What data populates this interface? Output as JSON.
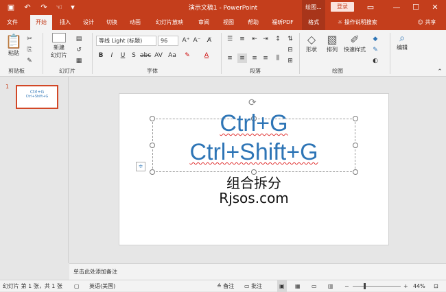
{
  "window": {
    "doc_title": "演示文稿1  -  PowerPoint",
    "context_tab": "绘图...",
    "login": "登录"
  },
  "quick_access": [
    "save-icon",
    "undo-icon",
    "redo-icon",
    "touch-mode-icon",
    "customize-icon"
  ],
  "tabs": [
    {
      "label": "文件"
    },
    {
      "label": "开始"
    },
    {
      "label": "插入"
    },
    {
      "label": "设计"
    },
    {
      "label": "切换"
    },
    {
      "label": "动画"
    },
    {
      "label": "幻灯片放映"
    },
    {
      "label": "审阅"
    },
    {
      "label": "视图"
    },
    {
      "label": "帮助"
    },
    {
      "label": "福昕PDF"
    },
    {
      "label": "格式"
    }
  ],
  "tell_me": "操作说明搜索",
  "share": "共享",
  "ribbon": {
    "paste": "粘贴",
    "new_slide_1": "新建",
    "new_slide_2": "幻灯片",
    "font_name": "等线 Light (标题)",
    "font_size": "96",
    "shape": "形状",
    "arrange": "排列",
    "quick_style": "快速样式",
    "edit": "编辑",
    "groups": {
      "clipboard": "剪贴板",
      "slides": "幻灯片",
      "font": "字体",
      "paragraph": "段落",
      "drawing": "绘图"
    }
  },
  "thumb": {
    "number": "1",
    "line1": "Ctrl+G",
    "line2": "Ctrl+Shift+G"
  },
  "slide": {
    "line1": "Ctrl+G",
    "line2": "Ctrl+Shift+G",
    "line3": "组合拆分",
    "line4": "Rjsos.com"
  },
  "notes": "单击此处添加备注",
  "status": {
    "slide_info": "幻灯片 第 1 张，共 1 张",
    "language": "英语(美国)",
    "notes_btn": "备注",
    "comments_btn": "批注",
    "zoom": "44%"
  },
  "colors": {
    "brand": "#c43e1c",
    "title_text": "#2e75b6"
  }
}
